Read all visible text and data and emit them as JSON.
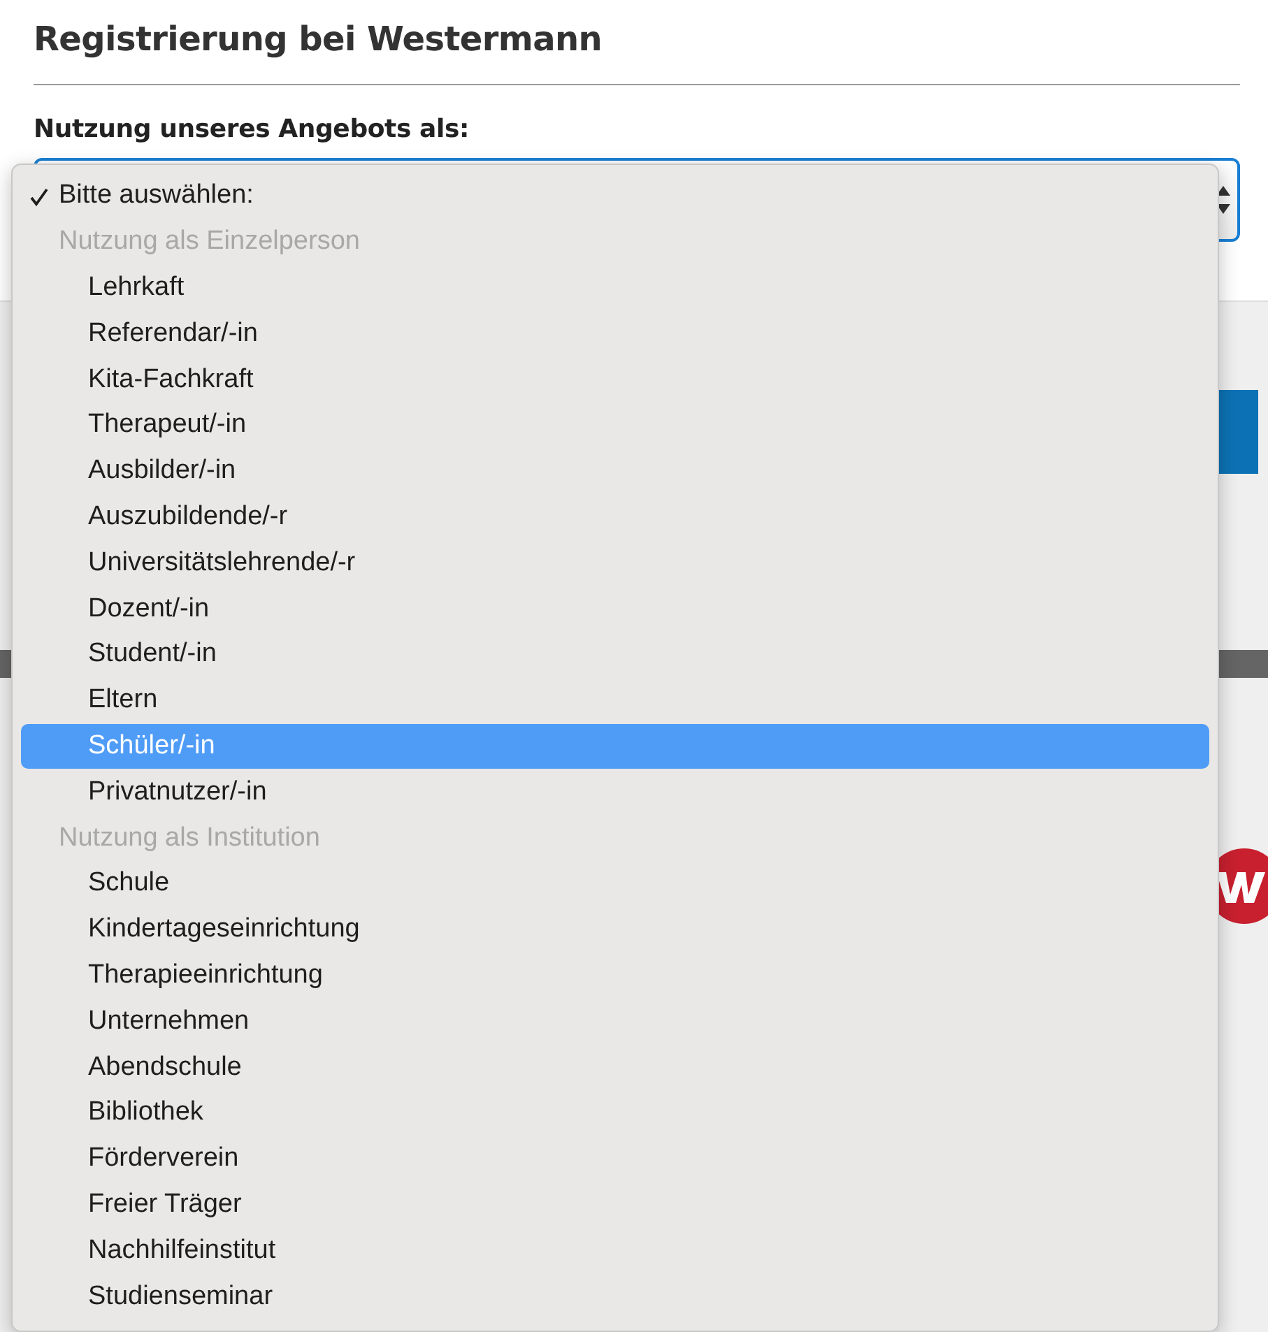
{
  "page": {
    "title": "Registrierung bei Westermann",
    "field_label": "Nutzung unseres Angebots als:"
  },
  "dropdown": {
    "items": [
      {
        "kind": "option",
        "label": "Bitte auswählen:",
        "checked": true,
        "selected": false
      },
      {
        "kind": "group",
        "label": "Nutzung als Einzelperson",
        "options": [
          {
            "label": "Lehrkaft",
            "selected": false
          },
          {
            "label": "Referendar/-in",
            "selected": false
          },
          {
            "label": "Kita-Fachkraft",
            "selected": false
          },
          {
            "label": "Therapeut/-in",
            "selected": false
          },
          {
            "label": "Ausbilder/-in",
            "selected": false
          },
          {
            "label": "Auszubildende/-r",
            "selected": false
          },
          {
            "label": "Universitätslehrende/-r",
            "selected": false
          },
          {
            "label": "Dozent/-in",
            "selected": false
          },
          {
            "label": "Student/-in",
            "selected": false
          },
          {
            "label": "Eltern",
            "selected": false
          },
          {
            "label": "Schüler/-in",
            "selected": true
          },
          {
            "label": "Privatnutzer/-in",
            "selected": false
          }
        ]
      },
      {
        "kind": "group",
        "label": "Nutzung als Institution",
        "options": [
          {
            "label": "Schule",
            "selected": false
          },
          {
            "label": "Kindertageseinrichtung",
            "selected": false
          },
          {
            "label": "Therapieeinrichtung",
            "selected": false
          },
          {
            "label": "Unternehmen",
            "selected": false
          },
          {
            "label": "Abendschule",
            "selected": false
          },
          {
            "label": "Bibliothek",
            "selected": false
          },
          {
            "label": "Förderverein",
            "selected": false
          },
          {
            "label": "Freier Träger",
            "selected": false
          },
          {
            "label": "Nachhilfeinstitut",
            "selected": false
          },
          {
            "label": "Studienseminar",
            "selected": false
          }
        ]
      }
    ]
  }
}
